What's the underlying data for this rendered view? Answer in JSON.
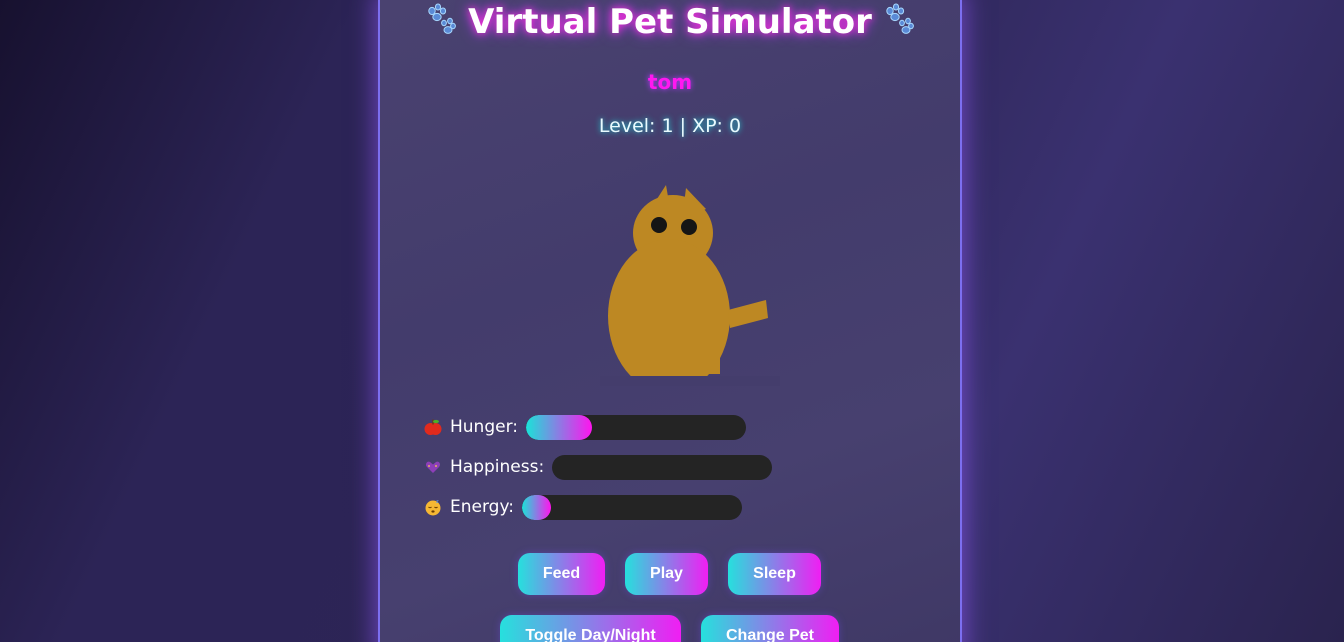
{
  "app": {
    "title": "Virtual Pet Simulator",
    "title_icon": "paw-prints-icon"
  },
  "pet": {
    "name": "tom",
    "level_line": "Level: 1 | XP: 0",
    "species": "cat",
    "color": "#bd8823"
  },
  "stats": [
    {
      "emoji": "apple-icon",
      "label": "Hunger:",
      "value_fraction": 0.3
    },
    {
      "emoji": "sparkle-heart-icon",
      "label": "Happiness:",
      "value_fraction": 0.0
    },
    {
      "emoji": "sleepy-face-icon",
      "label": "Energy:",
      "value_fraction": 0.13
    }
  ],
  "actions": {
    "feed": "Feed",
    "play": "Play",
    "sleep": "Sleep",
    "toggle_day_night": "Toggle Day/Night",
    "change_pet": "Change Pet"
  },
  "colors": {
    "accent_cyan": "#1ae3d8",
    "accent_magenta": "#ff14ee",
    "name_color": "#ff18f0",
    "bar_track": "#242424"
  }
}
